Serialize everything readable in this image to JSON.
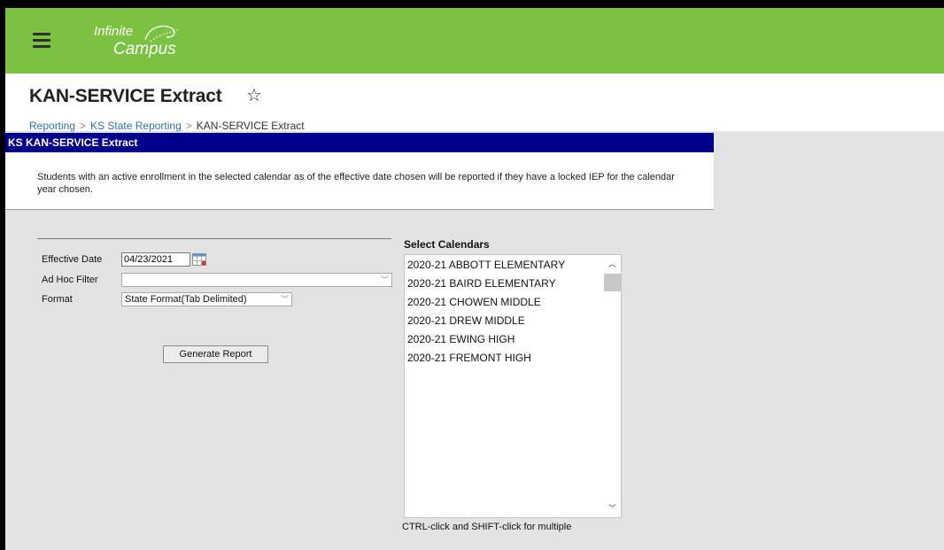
{
  "app": {
    "logo_line1": "Infinite",
    "logo_line2": "Campus",
    "brand_color": "#7cc242"
  },
  "page": {
    "title": "KAN-SERVICE Extract",
    "favorite_icon": "star-outline-icon",
    "breadcrumb": [
      "Reporting",
      "KS State Reporting",
      "KAN-SERVICE Extract"
    ]
  },
  "panel": {
    "header": "KS KAN-SERVICE Extract",
    "header_color": "#00008b",
    "description": "Students with an active enrollment in the selected calendar as of the effective date chosen will be reported if they have a locked IEP for the calendar year chosen."
  },
  "form": {
    "effective_date_label": "Effective Date",
    "effective_date_value": "04/23/2021",
    "ad_hoc_label": "Ad Hoc Filter",
    "ad_hoc_value": "",
    "format_label": "Format",
    "format_value": "State Format(Tab Delimited)",
    "generate_label": "Generate Report"
  },
  "calendars": {
    "title": "Select Calendars",
    "items": [
      "2020-21 ABBOTT ELEMENTARY",
      "2020-21 BAIRD ELEMENTARY",
      "2020-21 CHOWEN MIDDLE",
      "2020-21 DREW MIDDLE",
      "2020-21 EWING HIGH",
      "2020-21 FREMONT HIGH"
    ],
    "hint": "CTRL-click and SHIFT-click for multiple"
  }
}
